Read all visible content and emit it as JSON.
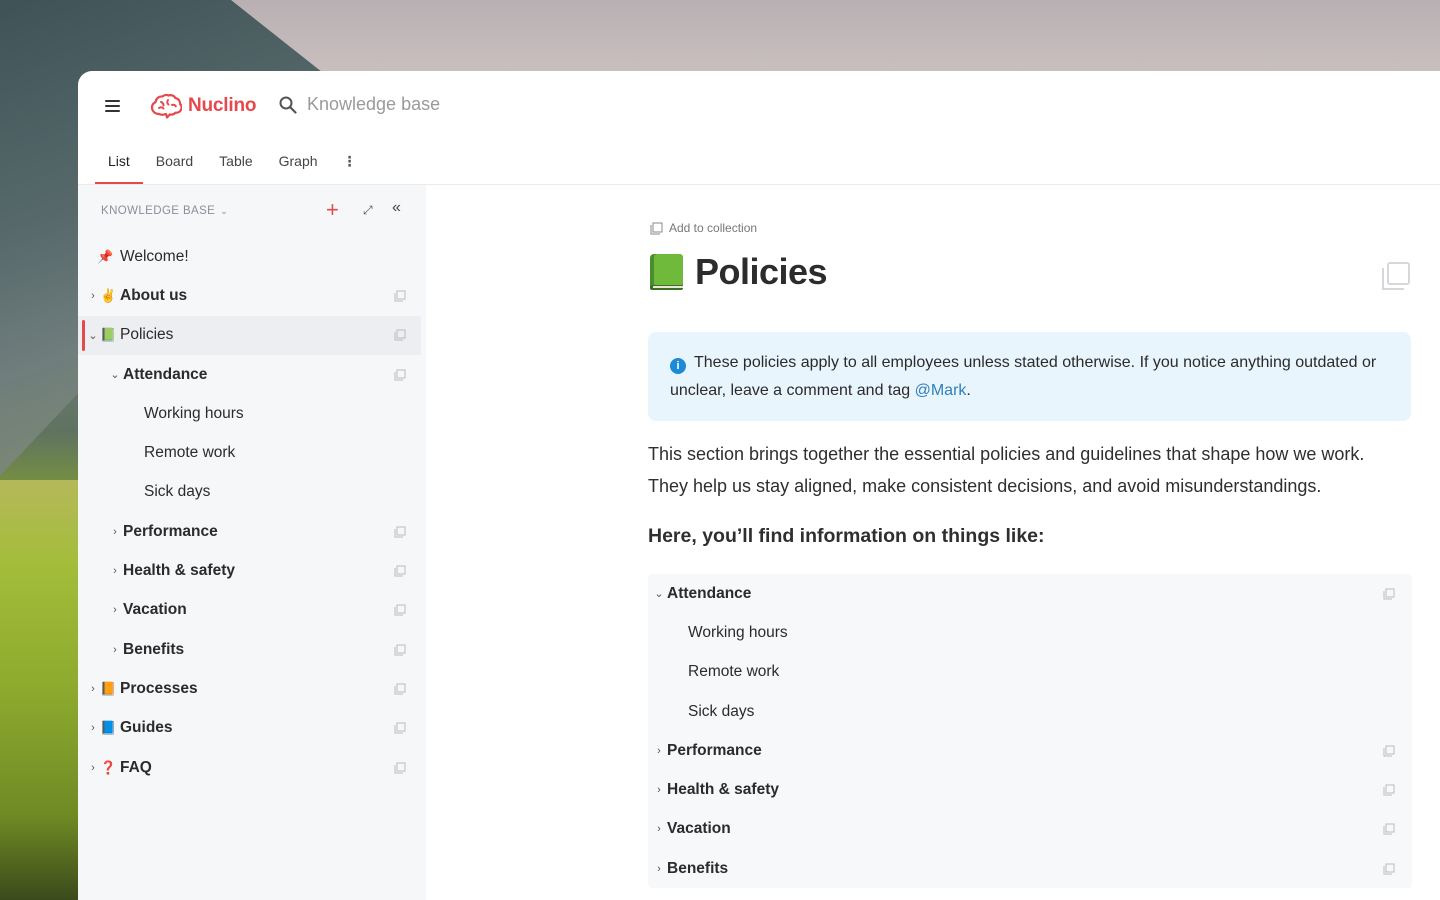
{
  "app": {
    "logo_text": "Nuclino",
    "search_placeholder": "Knowledge base",
    "accent": "#e5484d"
  },
  "view_tabs": [
    {
      "label": "List",
      "active": true
    },
    {
      "label": "Board",
      "active": false
    },
    {
      "label": "Table",
      "active": false
    },
    {
      "label": "Graph",
      "active": false
    }
  ],
  "view_tabs_more": "⋮",
  "sidebar": {
    "header": "KNOWLEDGE BASE",
    "items": [
      {
        "label": "Welcome!",
        "icon": "📌",
        "icon_name": "pin-icon"
      },
      {
        "label": "About us",
        "icon": "✌️",
        "icon_name": "victory-hand-icon"
      },
      {
        "label": "Policies",
        "icon": "📗",
        "icon_name": "green-book-icon"
      },
      {
        "label": "Attendance"
      },
      {
        "label": "Working hours"
      },
      {
        "label": "Remote work"
      },
      {
        "label": "Sick days"
      },
      {
        "label": "Performance"
      },
      {
        "label": "Health & safety"
      },
      {
        "label": "Vacation"
      },
      {
        "label": "Benefits"
      },
      {
        "label": "Processes",
        "icon": "📙",
        "icon_name": "orange-book-icon"
      },
      {
        "label": "Guides",
        "icon": "📘",
        "icon_name": "blue-book-icon"
      },
      {
        "label": "FAQ",
        "icon": "❓",
        "icon_name": "question-mark-icon"
      }
    ]
  },
  "document": {
    "add_to_collection": "Add to collection",
    "title": "Policies",
    "callout_text": "These policies apply to all employees unless stated otherwise. If you notice anything outdated or unclear, leave a comment and tag ",
    "callout_mention": "@Mark",
    "callout_end": ".",
    "paragraph": "This section brings together the essential policies and guidelines that shape how we work. They help us stay aligned, make consistent decisions, and avoid misunderstandings.",
    "heading": "Here, you’ll find information on things like:",
    "embed_items": [
      {
        "label": "Attendance"
      },
      {
        "label": "Working hours"
      },
      {
        "label": "Remote work"
      },
      {
        "label": "Sick days"
      },
      {
        "label": "Performance"
      },
      {
        "label": "Health & safety"
      },
      {
        "label": "Vacation"
      },
      {
        "label": "Benefits"
      }
    ]
  }
}
